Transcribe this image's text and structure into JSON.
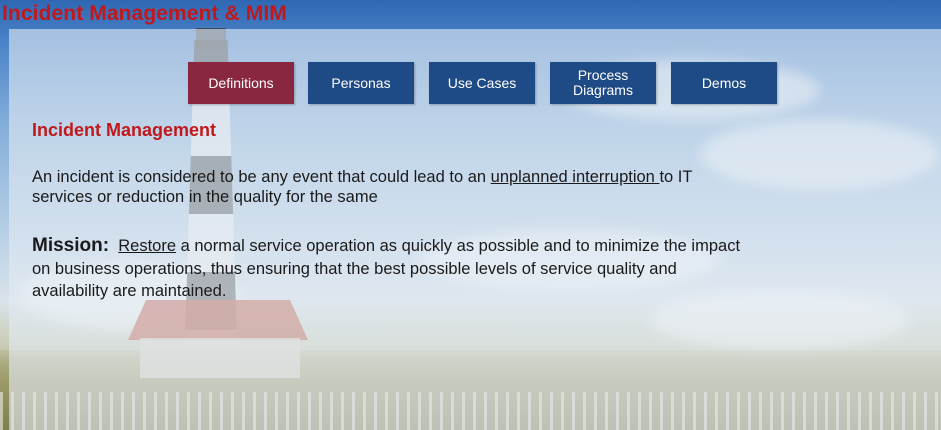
{
  "slide": {
    "title": "Incident Management & MIM"
  },
  "nav": {
    "tabs": [
      {
        "label": "Definitions",
        "active": true
      },
      {
        "label": "Personas",
        "active": false
      },
      {
        "label": "Use Cases",
        "active": false
      },
      {
        "label": "Process\nDiagrams",
        "active": false
      },
      {
        "label": "Demos",
        "active": false
      }
    ]
  },
  "content": {
    "heading": "Incident Management",
    "definition": {
      "before": "An incident is considered to be any event that could lead to an ",
      "link": "unplanned interruption ",
      "after_line1": "to IT",
      "line2": "services or reduction in the quality for the same"
    },
    "mission": {
      "label": "Mission:",
      "link": "Restore",
      "line1_rest": " a normal service operation as quickly as possible and to minimize the impact",
      "line2": "on business operations, thus ensuring that the best possible levels of service quality and",
      "line3": "availability are maintained."
    }
  },
  "colors": {
    "title_red": "#c0181b",
    "nav_blue": "#1e4a85",
    "nav_active": "#8a2740",
    "text_dark": "#1a1a1a"
  },
  "background": {
    "image_subject": "lighthouse-on-beach-photo"
  }
}
